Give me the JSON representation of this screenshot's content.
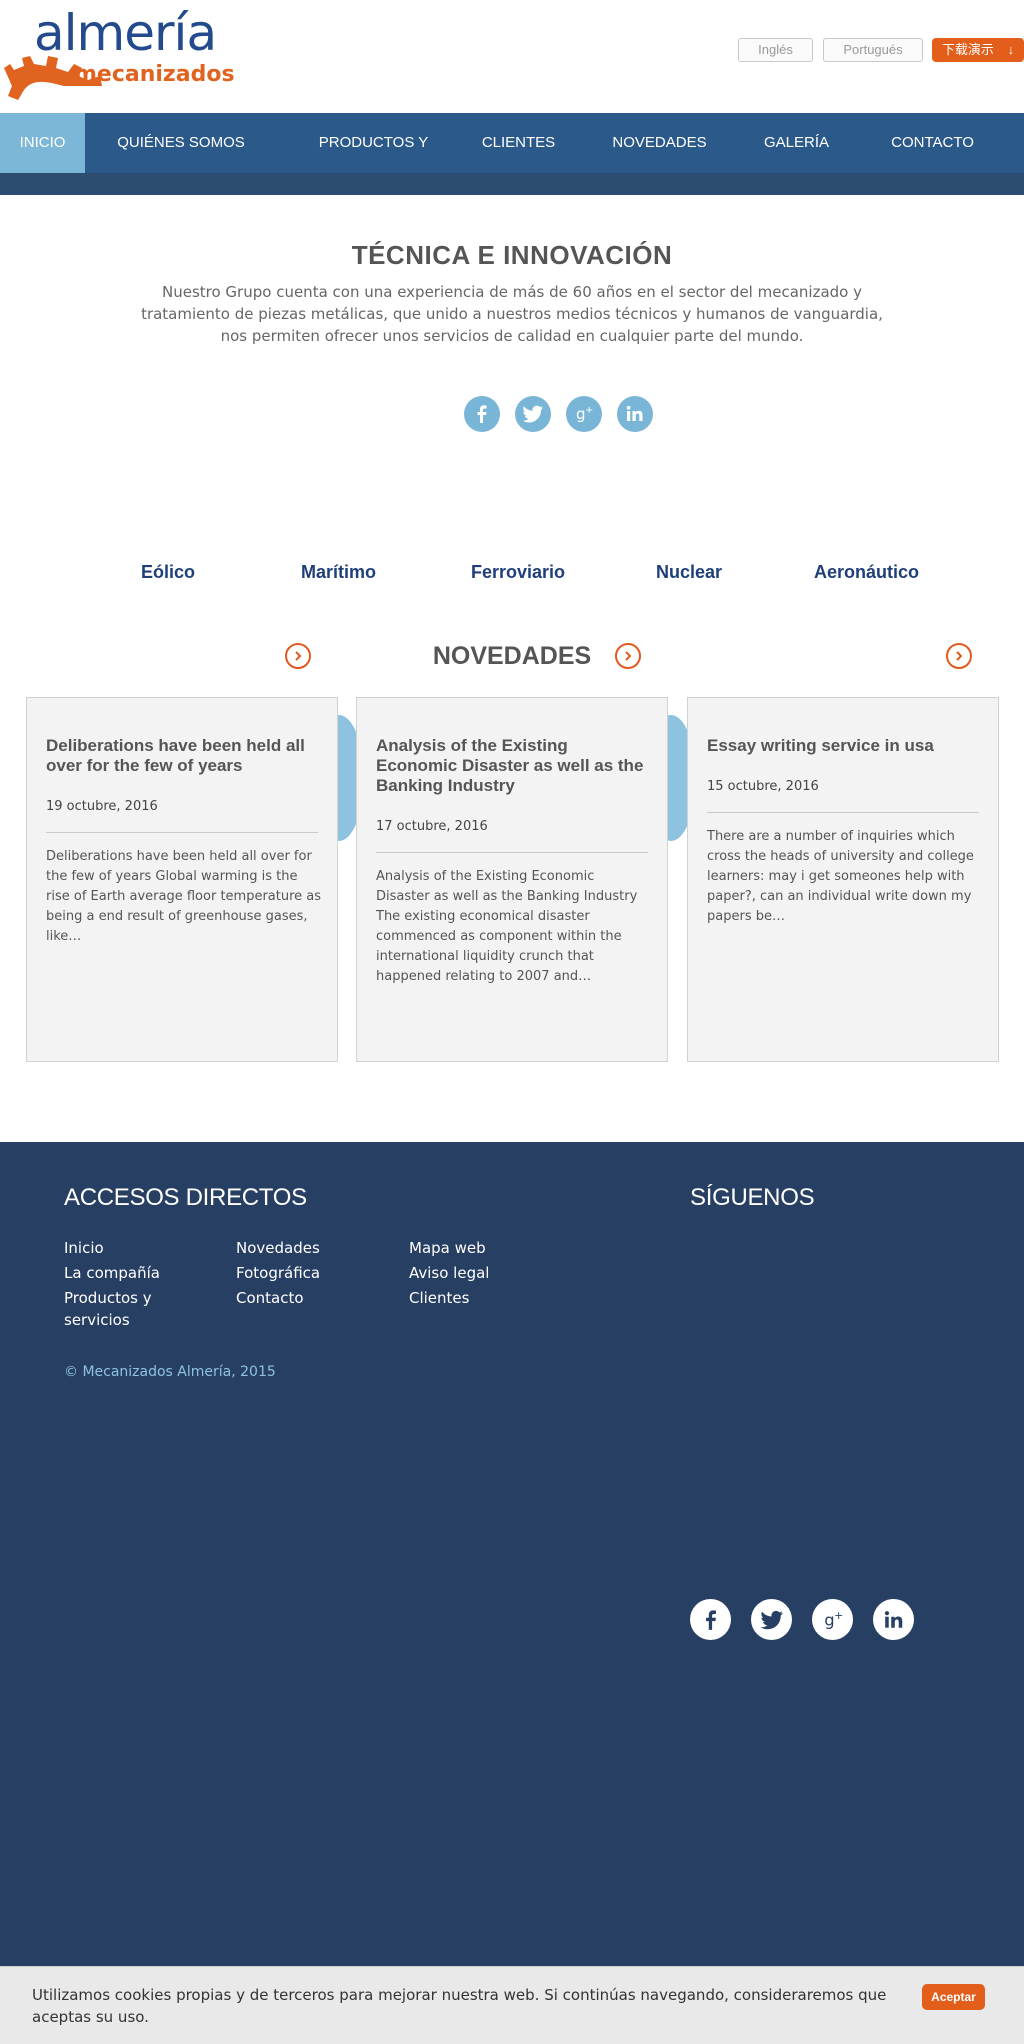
{
  "logo": {
    "line1": "almería",
    "line2": "mecanizados"
  },
  "languages": {
    "en": "Inglés",
    "pt": "Portugués",
    "download": "下载演示"
  },
  "nav": [
    {
      "label": "INICIO",
      "active": true
    },
    {
      "label": "QUIÉNES SOMOS"
    },
    {
      "label": "PRODUCTOS Y SERVICIOS"
    },
    {
      "label": "CLIENTES"
    },
    {
      "label": "NOVEDADES"
    },
    {
      "label": "GALERÍA"
    },
    {
      "label": "CONTACTO"
    }
  ],
  "intro": {
    "title": "TÉCNICA E INNOVACIÓN",
    "text": "Nuestro Grupo cuenta con una experiencia de más de 60 años en el sector del mecanizado y tratamiento de piezas metálicas, que unido a nuestros medios técnicos y humanos de vanguardia, nos permiten ofrecer unos servicios de calidad en cualquier parte del mundo."
  },
  "social_icons": [
    "facebook-icon",
    "twitter-icon",
    "google-plus-icon",
    "linkedin-icon"
  ],
  "sectors": [
    "Eólico",
    "Marítimo",
    "Ferroviario",
    "Nuclear",
    "Aeronáutico"
  ],
  "novedades": {
    "title": "NOVEDADES",
    "cards": [
      {
        "title": "Deliberations have been held all over for the few of years",
        "date": "19 octubre, 2016",
        "excerpt": "Deliberations have been held all over for the few of years Global warming is the rise of Earth average floor temperature as being a end result of greenhouse gases, like…"
      },
      {
        "title": "Analysis of the Existing Economic Disaster as well as the Banking Industry",
        "date": "17 octubre, 2016",
        "excerpt": "Analysis of the Existing Economic Disaster as well as the Banking Industry The existing economical disaster commenced as component within the international liquidity crunch that happened relating to 2007 and…"
      },
      {
        "title": "Essay writing service in usa",
        "date": "15 octubre, 2016",
        "excerpt": "There are a number of inquiries which cross the heads of university and college learners: may i get someones help with paper?, can an individual write down my papers be…"
      }
    ]
  },
  "footer": {
    "accesos_title": "ACCESOS DIRECTOS",
    "siguenos_title": "SÍGUENOS",
    "col1": [
      "Inicio",
      "La compañía",
      "Productos y servicios"
    ],
    "col2": [
      "Novedades",
      "Fotográfica",
      "Contacto"
    ],
    "col3": [
      "Mapa web",
      "Aviso legal",
      "Clientes"
    ],
    "copyright": "© Mecanizados Almería, 2015"
  },
  "cookie": {
    "text": "Utilizamos cookies propias y de terceros para mejorar nuestra web. Si continúas navegando, consideraremos que aceptas su uso.",
    "button": "Aceptar"
  },
  "colors": {
    "nav_bg": "#2b5a8a",
    "nav_active": "#7db7d8",
    "accent_orange": "#e45e1b",
    "footer_bg": "#273f63",
    "sector_blue": "#1f3f7a",
    "social_blue": "#78b5d6"
  }
}
